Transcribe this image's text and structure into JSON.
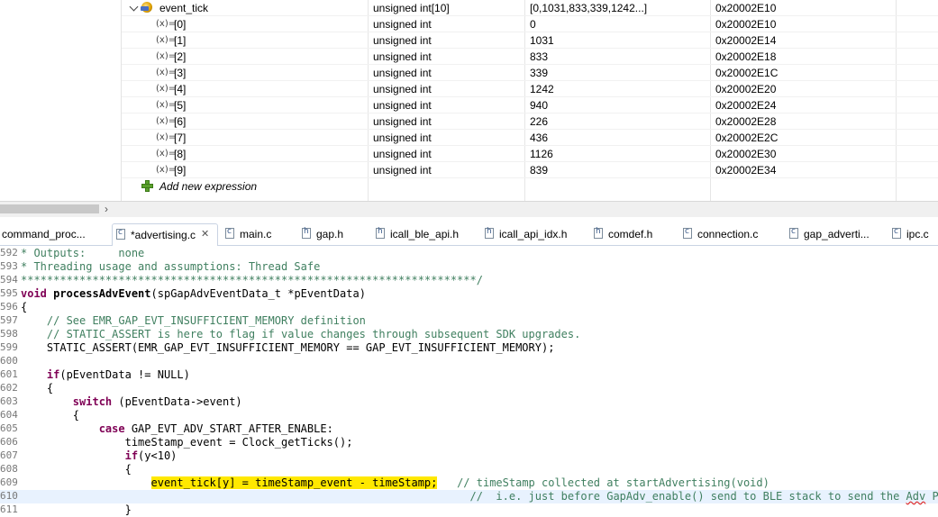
{
  "expressions": {
    "parent": {
      "name": "event_tick",
      "type": "unsigned int[10]",
      "value": "[0,1031,833,339,1242...]",
      "address": "0x20002E10"
    },
    "children": [
      {
        "name": "[0]",
        "type": "unsigned int",
        "value": "0",
        "address": "0x20002E10"
      },
      {
        "name": "[1]",
        "type": "unsigned int",
        "value": "1031",
        "address": "0x20002E14"
      },
      {
        "name": "[2]",
        "type": "unsigned int",
        "value": "833",
        "address": "0x20002E18"
      },
      {
        "name": "[3]",
        "type": "unsigned int",
        "value": "339",
        "address": "0x20002E1C"
      },
      {
        "name": "[4]",
        "type": "unsigned int",
        "value": "1242",
        "address": "0x20002E20"
      },
      {
        "name": "[5]",
        "type": "unsigned int",
        "value": "940",
        "address": "0x20002E24"
      },
      {
        "name": "[6]",
        "type": "unsigned int",
        "value": "226",
        "address": "0x20002E28"
      },
      {
        "name": "[7]",
        "type": "unsigned int",
        "value": "436",
        "address": "0x20002E2C"
      },
      {
        "name": "[8]",
        "type": "unsigned int",
        "value": "1126",
        "address": "0x20002E30"
      },
      {
        "name": "[9]",
        "type": "unsigned int",
        "value": "839",
        "address": "0x20002E34"
      }
    ],
    "var_icon": "(x)=",
    "add_label": "Add new expression"
  },
  "scroll_arrow": "›",
  "tabs": [
    {
      "label": "command_proc...",
      "kind": "c",
      "active": false
    },
    {
      "label": "*advertising.c",
      "kind": "c",
      "active": true,
      "close": "✕"
    },
    {
      "label": "main.c",
      "kind": "c",
      "active": false
    },
    {
      "label": "gap.h",
      "kind": "h",
      "active": false
    },
    {
      "label": "icall_ble_api.h",
      "kind": "h",
      "active": false
    },
    {
      "label": "icall_api_idx.h",
      "kind": "h",
      "active": false
    },
    {
      "label": "comdef.h",
      "kind": "h",
      "active": false
    },
    {
      "label": "connection.c",
      "kind": "c",
      "active": false
    },
    {
      "label": "gap_adverti...",
      "kind": "c",
      "active": false
    },
    {
      "label": "ipc.c",
      "kind": "c",
      "active": false
    }
  ],
  "code_lines": [
    {
      "n": "592",
      "t": "* Outputs:     none"
    },
    {
      "n": "593",
      "t": "* Threading usage and assumptions: Thread Safe"
    },
    {
      "n": "594",
      "t": "**********************************************************************/"
    },
    {
      "n": "595",
      "t": "void processAdvEvent(spGapAdvEventData_t *pEventData)"
    },
    {
      "n": "596",
      "t": "{"
    },
    {
      "n": "597",
      "t": "    // See EMR_GAP_EVT_INSUFFICIENT_MEMORY definition"
    },
    {
      "n": "598",
      "t": "    // STATIC_ASSERT is here to flag if value changes through subsequent SDK upgrades."
    },
    {
      "n": "599",
      "t": "    STATIC_ASSERT(EMR_GAP_EVT_INSUFFICIENT_MEMORY == GAP_EVT_INSUFFICIENT_MEMORY);"
    },
    {
      "n": "600",
      "t": ""
    },
    {
      "n": "601",
      "t": "    if(pEventData != NULL)"
    },
    {
      "n": "602",
      "t": "    {"
    },
    {
      "n": "603",
      "t": "        switch (pEventData->event)"
    },
    {
      "n": "604",
      "t": "        {"
    },
    {
      "n": "605",
      "t": "            case GAP_EVT_ADV_START_AFTER_ENABLE:"
    },
    {
      "n": "606",
      "t": "                timeStamp_event = Clock_getTicks();"
    },
    {
      "n": "607",
      "t": "                if(y<10)"
    },
    {
      "n": "608",
      "t": "                {"
    },
    {
      "n": "609",
      "t": "                    event_tick[y] = timeStamp_event - timeStamp;   // timeStamp collected at startAdvertising(void)"
    },
    {
      "n": "610",
      "t": "                                                                     //  i.e. just before GapAdv_enable() send to BLE stack to send the Adv Packet"
    },
    {
      "n": "611",
      "t": "                }"
    }
  ]
}
